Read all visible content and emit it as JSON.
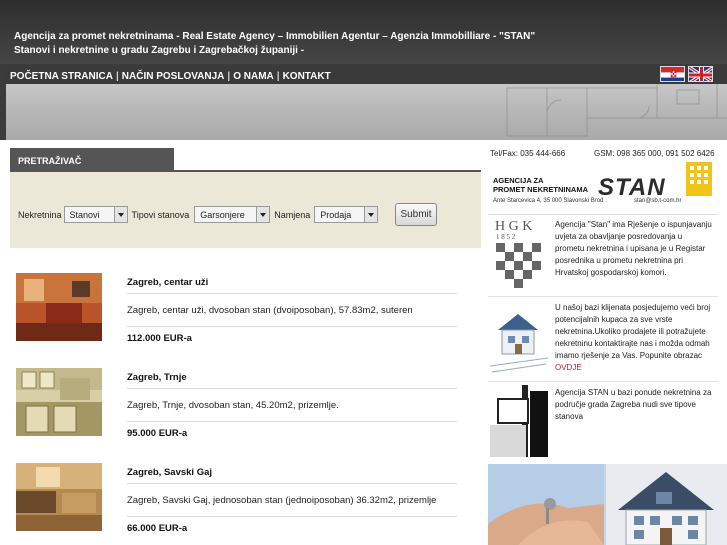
{
  "header": {
    "tagline_line1": "Agencija za promet nekretninama - Real Estate Agency – Immobilien Agentur – Agenzia Immobilliare - \"STAN\"",
    "tagline_line2": "Stanovi i nekretnine u gradu Zagrebu i Zagrebačkoj županiji -"
  },
  "nav": {
    "items": [
      "POČETNA STRANICA",
      "NAČIN POSLOVANJA",
      "O NAMA",
      "KONTAKT"
    ],
    "separator": "|"
  },
  "flags": [
    "croatian-flag-icon",
    "uk-flag-icon"
  ],
  "search": {
    "tab_label": "PRETRAŽIVAČ",
    "nekretnina_label": "Nekretnina",
    "nekretnina_value": "Stanovi",
    "tipovi_label": "Tipovi stanova",
    "tipovi_value": "Garsonjere",
    "namjena_label": "Namjena",
    "namjena_value": "Prodaja",
    "submit_label": "Submit"
  },
  "listings": [
    {
      "title": "Zagreb, centar uži",
      "desc": "Zagreb, centar uži, dvosoban stan (dvoiposoban), 57.83m2, suteren",
      "price": "112.000 EUR-a"
    },
    {
      "title": "Zagreb, Trnje",
      "desc": "Zagreb, Trnje, dvosoban stan, 45.20m2, prizemlje.",
      "price": "95.000 EUR-a"
    },
    {
      "title": "Zagreb, Savski Gaj",
      "desc": "Zagreb, Savski Gaj, jednosoban stan (jednoiposoban) 36.32m2, prizemlje",
      "price": "66.000 EUR-a"
    }
  ],
  "contact": {
    "telfax": "Tel/Fax: 035 444-666",
    "gsm": "GSM: 098 365 000, 091 502 6426"
  },
  "logo": {
    "agency_line1": "AGENCIJA ZA",
    "agency_line2": "PROMET NEKRETNINAMA",
    "brand": "STAN",
    "address": "Ante Starcevica 4, 35 000 Slavonski Brod",
    "email": "stan@sb.t-com.hr"
  },
  "hgk": {
    "letters": "H G K",
    "year": "1 8 5 2"
  },
  "info_blocks": [
    {
      "text": "Agencija \"Stan\" ima Rješenje o ispunjavanju uvjeta za obavljanje posredovanja u prometu nekretnina i upisana je u Registar posrednika u prometu nekretnina pri Hrvatskoj gospodarskoj komori."
    },
    {
      "text": "U našoj bazi klijenata posjedujemo veći broj potencijalnih kupaca za sve vrste nekretnina.Ukoliko prodajete ili potražujete nekretninu kontaktirajte nas i možda odmah imamo rješenje za Vas. Popunite obrazac ",
      "link": "OVDJE"
    },
    {
      "text": "Agencija STAN u bazi ponude nekretnina za područje grada Zagreba nudi sve tipove stanova"
    }
  ],
  "colors": {
    "header_dark": "#3b3b3b",
    "search_bg": "#ece8d8",
    "link_red": "#d02020"
  }
}
